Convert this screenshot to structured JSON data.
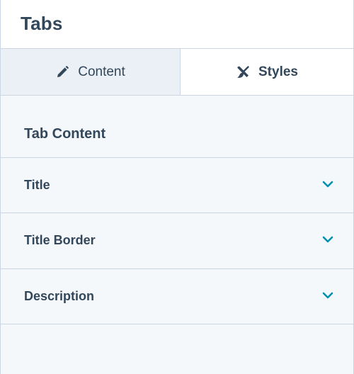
{
  "header": {
    "title": "Tabs"
  },
  "tabs": [
    {
      "label": "Content",
      "icon": "pencil-icon",
      "active": true
    },
    {
      "label": "Styles",
      "icon": "brush-ruler-icon",
      "active": false
    }
  ],
  "panel": {
    "heading": "Tab Content",
    "rows": [
      {
        "label": "Title",
        "icon": "chevron-down-icon"
      },
      {
        "label": "Title Border",
        "icon": "chevron-down-icon"
      },
      {
        "label": "Description",
        "icon": "chevron-down-icon"
      }
    ]
  },
  "colors": {
    "text": "#33475b",
    "accent": "#0091ae",
    "active_tab_bg": "#eaf0f6",
    "panel_bg": "#f5f8fa",
    "border": "#cbd6e2"
  }
}
